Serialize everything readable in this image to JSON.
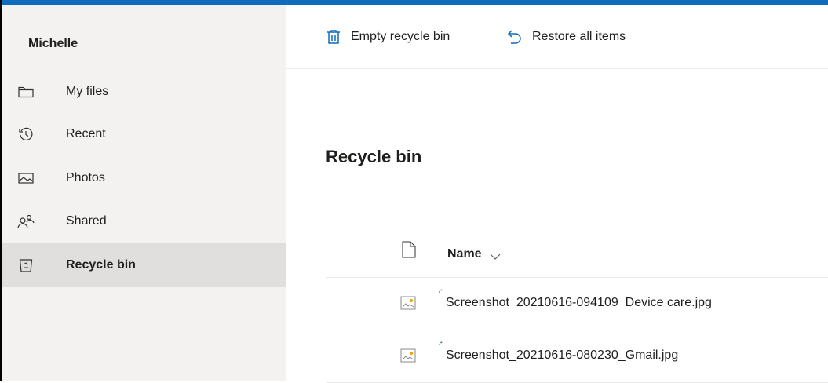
{
  "sidebar": {
    "user_name": "Michelle",
    "items": [
      {
        "label": "My files",
        "icon": "folder-icon",
        "selected": false
      },
      {
        "label": "Recent",
        "icon": "history-icon",
        "selected": false
      },
      {
        "label": "Photos",
        "icon": "photo-icon",
        "selected": false
      },
      {
        "label": "Shared",
        "icon": "shared-people-icon",
        "selected": false
      },
      {
        "label": "Recycle bin",
        "icon": "recycle-bin-icon",
        "selected": true
      }
    ]
  },
  "toolbar": {
    "empty_label": "Empty recycle bin",
    "empty_icon": "trash-icon",
    "restore_label": "Restore all items",
    "restore_icon": "undo-icon"
  },
  "main": {
    "title": "Recycle bin",
    "column_name": "Name",
    "rows": [
      {
        "name": "Screenshot_20210616-094109_Device care.jpg",
        "icon": "image-file-icon"
      },
      {
        "name": "Screenshot_20210616-080230_Gmail.jpg",
        "icon": "image-file-icon"
      }
    ]
  },
  "colors": {
    "accent": "#0f6cbd",
    "sidebar_bg": "#f3f2f1",
    "selected_bg": "#e1dfdd"
  }
}
